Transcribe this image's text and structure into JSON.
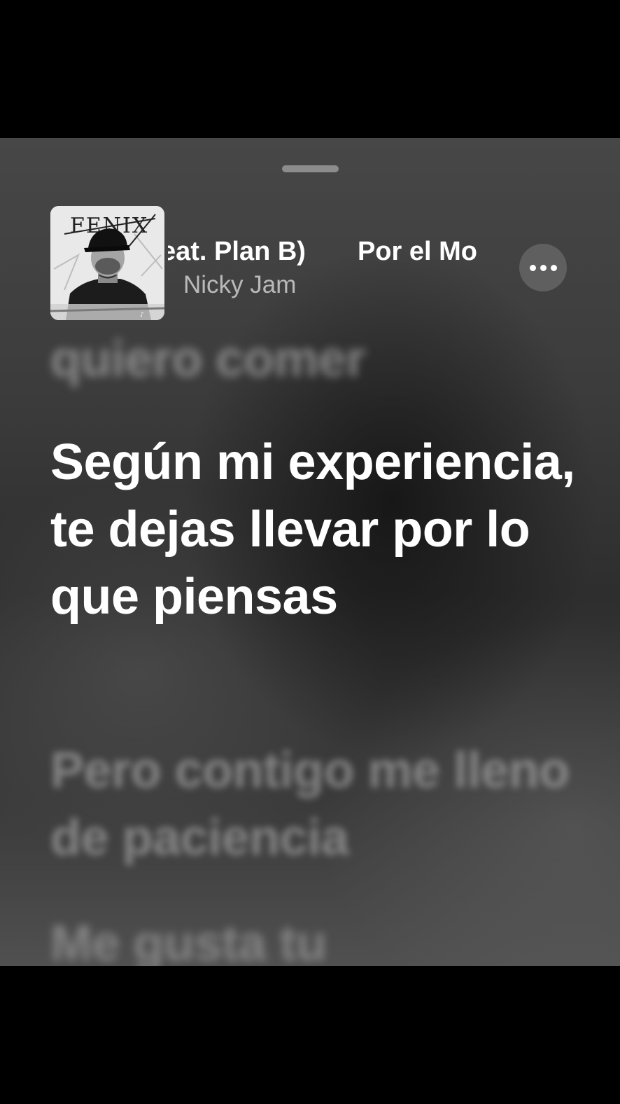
{
  "now_playing": {
    "title_segments": [
      "eat. Plan B)",
      "Por el Mo"
    ],
    "artist": "Nicky Jam",
    "artwork_text": "FENIX"
  },
  "more_button": {
    "icon": "ellipsis-icon"
  },
  "lyrics": {
    "previous": "quiero comer",
    "current": "Según mi experiencia, te dejas llevar por lo que piensas",
    "next": "Pero contigo me lleno de paciencia",
    "next2": "Me gusta tu"
  },
  "colors": {
    "lyric_active": "#ffffff",
    "artist": "#b9b9b9",
    "letterbox": "#000000"
  }
}
